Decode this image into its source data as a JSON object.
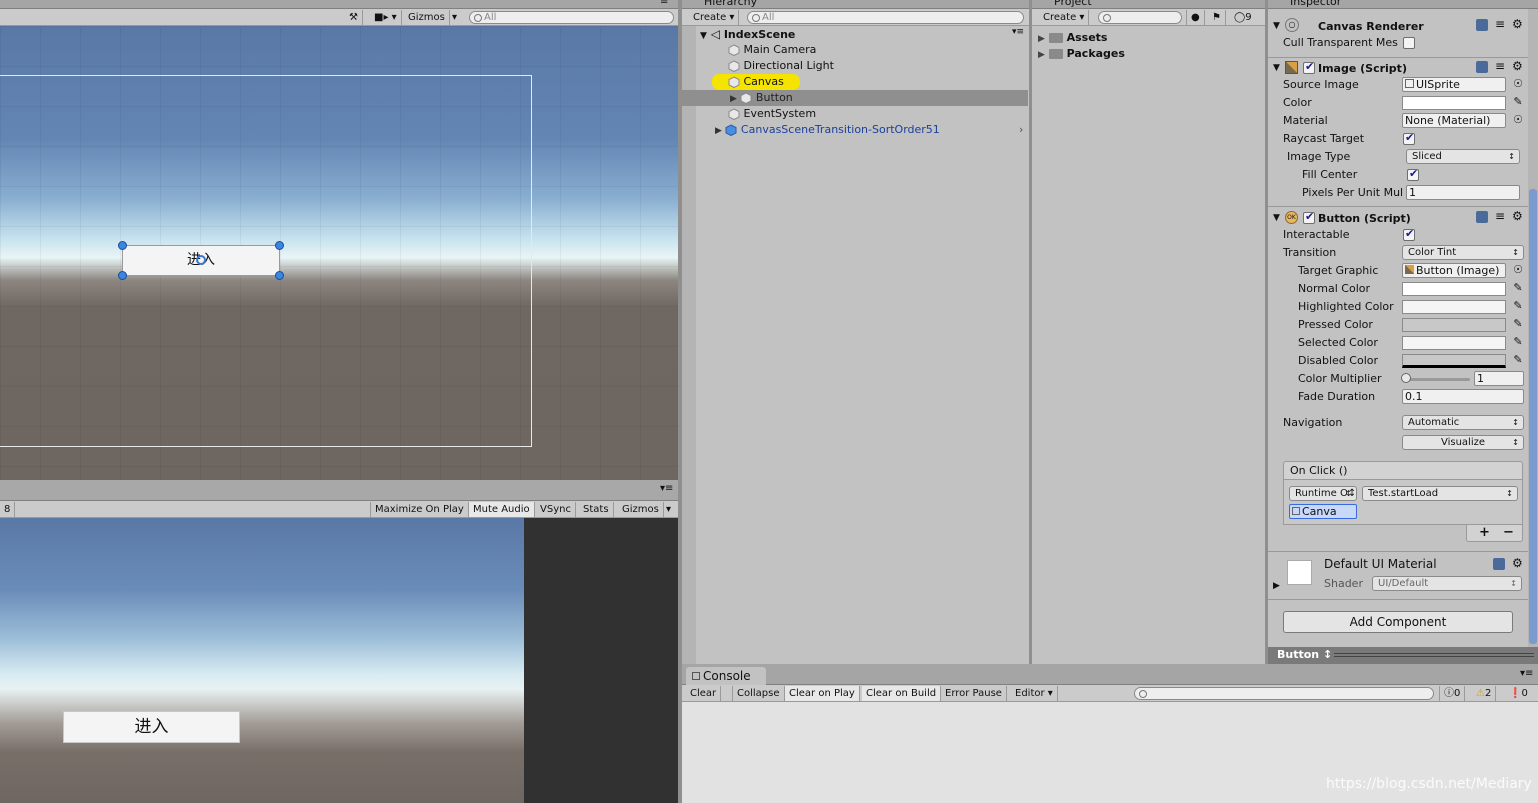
{
  "scene": {
    "tab_menu": "≡",
    "toolbar": {
      "gizmos_label": "Gizmos",
      "search_placeholder": "All"
    },
    "button_text": "进入"
  },
  "game": {
    "resolution_text": "8",
    "toolbar": [
      "Maximize On Play",
      "Mute Audio",
      "VSync",
      "Stats",
      "Gizmos"
    ],
    "button_text": "进入"
  },
  "hierarchy": {
    "tab_title": "Hierarchy",
    "create_label": "Create",
    "search_placeholder": "All",
    "scene_name": "IndexScene",
    "items": [
      {
        "label": "Main Camera"
      },
      {
        "label": "Directional Light"
      },
      {
        "label": "Canvas"
      },
      {
        "label": "Button"
      },
      {
        "label": "EventSystem"
      },
      {
        "label": "CanvasSceneTransition-SortOrder51"
      }
    ]
  },
  "project": {
    "tab_title": "Project",
    "create_label": "Create",
    "hidden_count": "9",
    "folders": [
      "Assets",
      "Packages"
    ]
  },
  "inspector": {
    "tab_title": "Inspector",
    "canvas_renderer": {
      "title": "Canvas Renderer",
      "cull_label": "Cull Transparent Mes"
    },
    "image": {
      "title": "Image (Script)",
      "source_image_label": "Source Image",
      "source_image_value": "UISprite",
      "color_label": "Color",
      "material_label": "Material",
      "material_value": "None (Material)",
      "raycast_label": "Raycast Target",
      "image_type_label": "Image Type",
      "image_type_value": "Sliced",
      "fill_center_label": "Fill Center",
      "ppu_label": "Pixels Per Unit Mul",
      "ppu_value": "1"
    },
    "button": {
      "title": "Button (Script)",
      "interactable_label": "Interactable",
      "transition_label": "Transition",
      "transition_value": "Color Tint",
      "target_graphic_label": "Target Graphic",
      "target_graphic_value": "Button (Image)",
      "normal_label": "Normal Color",
      "highlighted_label": "Highlighted Color",
      "pressed_label": "Pressed Color",
      "selected_label": "Selected Color",
      "disabled_label": "Disabled Color",
      "multiplier_label": "Color Multiplier",
      "multiplier_value": "1",
      "fade_label": "Fade Duration",
      "fade_value": "0.1",
      "navigation_label": "Navigation",
      "navigation_value": "Automatic",
      "visualize_label": "Visualize",
      "onclick_label": "On Click ()",
      "runtime_value": "Runtime O↕",
      "function_value": "Test.startLoad",
      "object_value": "Canva",
      "plus": "+",
      "minus": "−"
    },
    "material": {
      "title": "Default UI Material",
      "shader_label": "Shader",
      "shader_value": "UI/Default"
    },
    "add_component_label": "Add Component",
    "footer_label": "Button"
  },
  "console": {
    "tab_title": "Console",
    "buttons": [
      "Clear",
      "Collapse",
      "Clear on Play",
      "Clear on Build",
      "Error Pause",
      "Editor"
    ],
    "counts": {
      "info": "0",
      "warn": "2",
      "error": "0"
    },
    "watermark": "https://blog.csdn.net/Mediary"
  },
  "colors": {
    "accent_selected": "#f5e400",
    "link_blue": "#1b3f9a",
    "sky_top": "#5a78a6",
    "ground": "#6e6660"
  }
}
